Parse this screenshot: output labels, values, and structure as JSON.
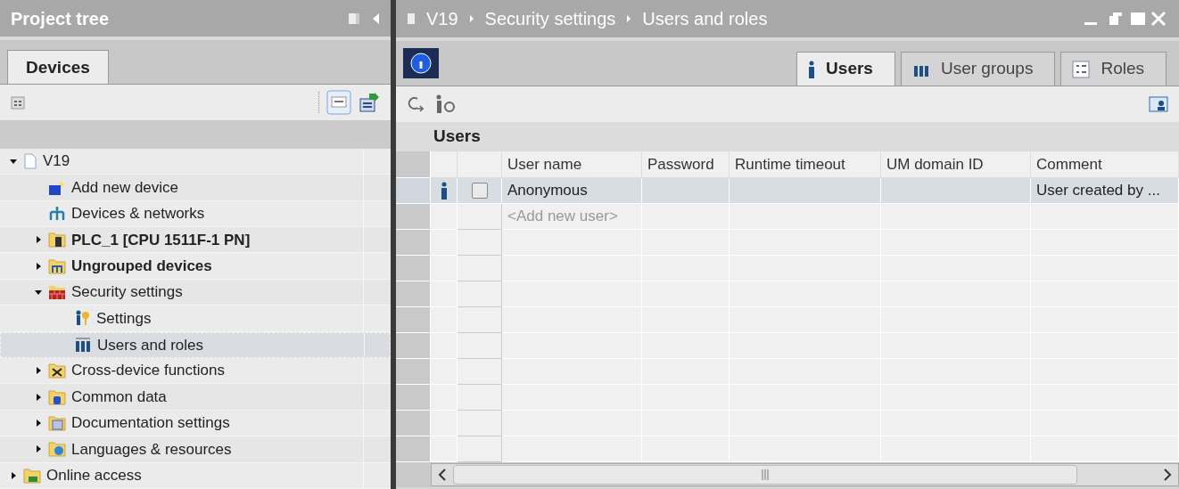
{
  "project_tree": {
    "title": "Project tree",
    "tabs": [
      {
        "label": "Devices",
        "selected": true
      }
    ],
    "items": [
      {
        "label": "V19",
        "expanded": true,
        "selected": false,
        "bold": false,
        "children": [
          {
            "label": "Add new device",
            "selected": false,
            "bold": false
          },
          {
            "label": "Devices & networks",
            "selected": false,
            "bold": false
          },
          {
            "label": "PLC_1 [CPU 1511F-1 PN]",
            "expanded": false,
            "selected": false,
            "bold": true
          },
          {
            "label": "Ungrouped devices",
            "expanded": false,
            "selected": false,
            "bold": true
          },
          {
            "label": "Security settings",
            "expanded": true,
            "selected": false,
            "bold": false,
            "children": [
              {
                "label": "Settings",
                "selected": false,
                "bold": false
              },
              {
                "label": "Users and roles",
                "selected": true,
                "bold": false
              }
            ]
          },
          {
            "label": "Cross-device functions",
            "expanded": false,
            "selected": false,
            "bold": false
          },
          {
            "label": "Common data",
            "expanded": false,
            "selected": false,
            "bold": false
          },
          {
            "label": "Documentation settings",
            "expanded": false,
            "selected": false,
            "bold": false
          },
          {
            "label": "Languages & resources",
            "expanded": false,
            "selected": false,
            "bold": false
          }
        ]
      },
      {
        "label": "Online access",
        "expanded": false,
        "selected": false,
        "bold": false
      }
    ]
  },
  "editor": {
    "breadcrumb": [
      "V19",
      "Security settings",
      "Users and roles"
    ],
    "tabs": [
      {
        "label": "Users",
        "selected": true
      },
      {
        "label": "User groups",
        "selected": false
      },
      {
        "label": "Roles",
        "selected": false
      }
    ],
    "section_title": "Users",
    "table": {
      "columns": [
        "User name",
        "Password",
        "Runtime timeout",
        "UM domain ID",
        "Comment"
      ],
      "rows": [
        {
          "user_name": "Anonymous",
          "comment": "User created by ...",
          "checked": false,
          "selected": true
        }
      ],
      "add_row_placeholder": "<Add new user>"
    }
  }
}
